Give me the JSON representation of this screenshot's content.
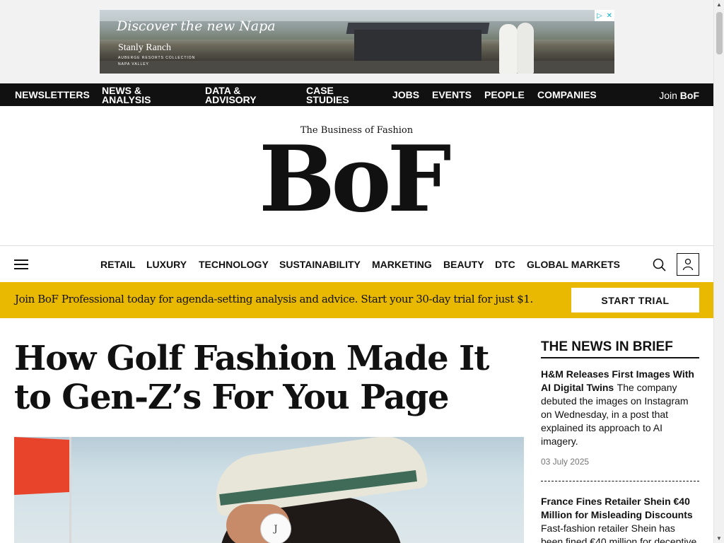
{
  "ad": {
    "headline": "Discover the new Napa",
    "brand": "Stanly Ranch",
    "brand_sub": "AUBERGE RESORTS COLLECTION NAPA VALLEY"
  },
  "topnav": {
    "items": [
      "NEWSLETTERS",
      "NEWS & ANALYSIS",
      "DATA & ADVISORY",
      "CASE STUDIES",
      "JOBS",
      "EVENTS",
      "PEOPLE",
      "COMPANIES"
    ],
    "join_prefix": "Join",
    "join_brand": "BoF"
  },
  "masthead": {
    "tagline": "The Business of Fashion",
    "logo_text": "BoF"
  },
  "sections": [
    "RETAIL",
    "LUXURY",
    "TECHNOLOGY",
    "SUSTAINABILITY",
    "MARKETING",
    "BEAUTY",
    "DTC",
    "GLOBAL MARKETS"
  ],
  "promo": {
    "text": "Join BoF Professional today for agenda-setting analysis and advice. Start your 30-day trial for just $1.",
    "cta": "START TRIAL"
  },
  "article": {
    "title": "How Golf Fashion Made It to Gen-Z’s For You Page"
  },
  "sidebar": {
    "heading": "THE NEWS IN BRIEF",
    "briefs": [
      {
        "title": "H&M Releases First Images With AI Digital Twins",
        "body": "The company debuted the images on Instagram on Wednesday, in a post that explained its approach to AI imagery.",
        "date": "03 July 2025"
      },
      {
        "title": "France Fines Retailer Shein €40 Million for Misleading Discounts",
        "body": "Fast-fashion retailer Shein has been fined €40 million for deceptive",
        "date": ""
      }
    ]
  },
  "colors": {
    "promo_bar": "#e8b900",
    "nav_bg": "#111111"
  }
}
